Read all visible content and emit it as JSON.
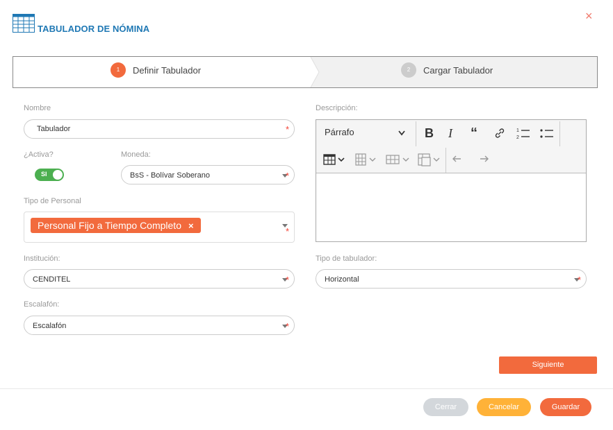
{
  "header": {
    "title": "TABULADOR DE NÓMINA",
    "icon": "table-grid-icon",
    "close_label": "×"
  },
  "steps": [
    {
      "number": "1",
      "label": "Definir Tabulador",
      "active": true,
      "color": "#f26a3d"
    },
    {
      "number": "2",
      "label": "Cargar Tabulador",
      "active": false,
      "color": "#cccccc"
    }
  ],
  "form": {
    "nombre": {
      "label": "Nombre",
      "value": "Tabulador"
    },
    "activa": {
      "label": "¿Activa?",
      "toggle_text": "SI",
      "on": true
    },
    "moneda": {
      "label": "Moneda:",
      "value": "BsS - Bolívar Soberano"
    },
    "tipo_personal": {
      "label": "Tipo de Personal",
      "tags": [
        "Personal Fijo a Tiempo Completo"
      ]
    },
    "institucion": {
      "label": "Institución:",
      "value": "CENDITEL"
    },
    "escalafon": {
      "label": "Escalafón:",
      "value": "Escalafón"
    },
    "descripcion": {
      "label": "Descripción:",
      "format": "Párrafo"
    },
    "tipo_tabulador": {
      "label": "Tipo de tabulador:",
      "value": "Horizontal"
    },
    "required_mark": "*"
  },
  "buttons": {
    "siguiente": "Siguiente",
    "cerrar": "Cerrar",
    "cancelar": "Cancelar",
    "guardar": "Guardar"
  },
  "colors": {
    "accent": "#f26a3d",
    "title": "#1f78b4",
    "toggle": "#4caf50",
    "cancel": "#ffb238",
    "disabled": "#d3d7db"
  }
}
